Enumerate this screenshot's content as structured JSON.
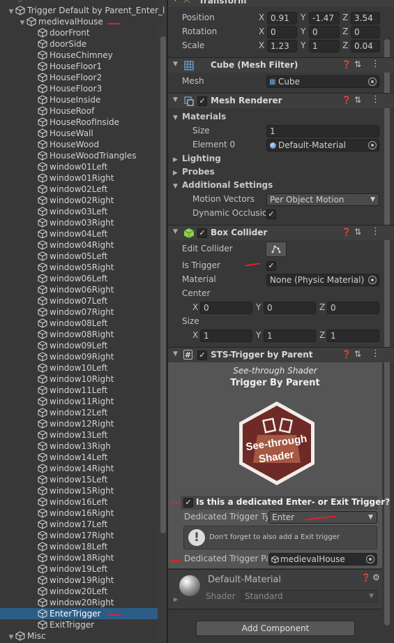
{
  "hierarchy": {
    "root": "Trigger Default by Parent_Enter_l",
    "parent": "medievalHouse",
    "children": [
      "doorFront",
      "doorSide",
      "HouseChimney",
      "HouseFloor1",
      "HouseFloor2",
      "HouseFloor3",
      "HouseInside",
      "HouseRoof",
      "HouseRoofInside",
      "HouseWall",
      "HouseWood",
      "HouseWoodTriangles",
      "window01Left",
      "window01Right",
      "window02Left",
      "window02Right",
      "window03Left",
      "window03Right",
      "window04Left",
      "window04Right",
      "window05Left",
      "window05Right",
      "window06Left",
      "window06Right",
      "window07Left",
      "window07Right",
      "window08Left",
      "window08Right",
      "window09Left",
      "window09Right",
      "window10Left",
      "window10Right",
      "window11Left",
      "window11Right",
      "window12Left",
      "window12Right",
      "window13Left",
      "window13Righ",
      "window14Left",
      "window14Right",
      "window15Left",
      "window15Right",
      "window16Left",
      "window16Right",
      "window17Left",
      "window17Right",
      "window18Left",
      "window18Right",
      "window19Left",
      "window19Right",
      "window20Left",
      "window20Right",
      "EnterTrigger",
      "ExitTrigger"
    ],
    "selected": "EnterTrigger",
    "misc": "Misc"
  },
  "transform": {
    "title": "Transform",
    "position_label": "Position",
    "rotation_label": "Rotation",
    "scale_label": "Scale",
    "position": {
      "x": "0.91",
      "y": "-1.47",
      "z": "3.54"
    },
    "rotation": {
      "x": "0",
      "y": "0",
      "z": "0"
    },
    "scale": {
      "x": "1.23",
      "y": "1",
      "z": "0.04"
    },
    "axis": {
      "x": "X",
      "y": "Y",
      "z": "Z"
    }
  },
  "mesh_filter": {
    "title": "Cube (Mesh Filter)",
    "mesh_label": "Mesh",
    "mesh_value": "Cube"
  },
  "mesh_renderer": {
    "title": "Mesh Renderer",
    "materials_label": "Materials",
    "size_label": "Size",
    "size_value": "1",
    "element0_label": "Element 0",
    "element0_value": "Default-Material",
    "lighting_label": "Lighting",
    "probes_label": "Probes",
    "additional_label": "Additional Settings",
    "motion_label": "Motion Vectors",
    "motion_value": "Per Object Motion",
    "dynamic_label": "Dynamic Occlusion"
  },
  "box_collider": {
    "title": "Box Collider",
    "edit_label": "Edit Collider",
    "trigger_label": "Is Trigger",
    "material_label": "Material",
    "material_value": "None (Physic Material)",
    "center_label": "Center",
    "center": {
      "x": "0",
      "y": "0",
      "z": "0"
    },
    "size_label": "Size",
    "size": {
      "x": "1",
      "y": "1",
      "z": "1"
    }
  },
  "sts": {
    "title": "STS-Trigger by Parent",
    "subtitle": "See-through Shader",
    "heading": "Trigger By Parent",
    "logo_text": "See-through Shader",
    "dedicated_label": "Is this a dedicated Enter- or Exit Trigger?",
    "type_label": "Dedicated Trigger Ty",
    "type_value": "Enter",
    "warning": "Don't forget to also add a Exit trigger",
    "parent_label": "Dedicated Trigger Pa",
    "parent_value": "medievalHouse"
  },
  "material": {
    "name": "Default-Material",
    "shader_label": "Shader",
    "shader_value": "Standard"
  },
  "add_component": "Add Component",
  "colors": {
    "selection": "#2c5d87",
    "accent_red": "#e0202a",
    "background": "#383838"
  }
}
